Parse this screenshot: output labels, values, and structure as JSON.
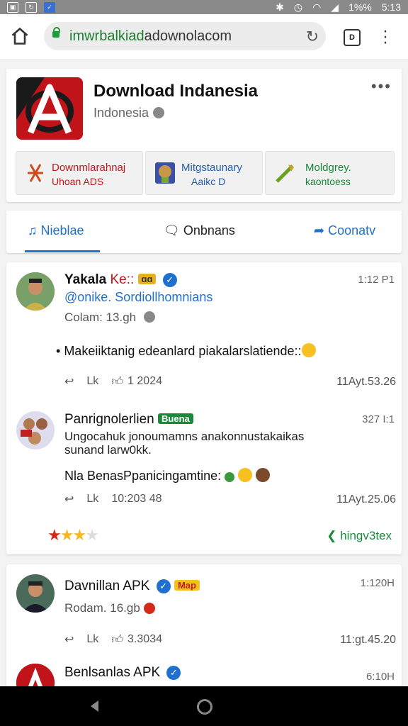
{
  "status_bar": {
    "battery": "1%%",
    "time": "5:13"
  },
  "browser": {
    "url_green": "imwrbalkiad",
    "url_rest": "adownolacom"
  },
  "app": {
    "title": "Download Indanesia",
    "subtitle": "Indonesia",
    "banners": [
      {
        "line1": "Downmlarahnaj",
        "line2": "Uhoan ADS",
        "color": "#c01818"
      },
      {
        "line1": "Mitgstaunary",
        "line2": "Aaikc D",
        "color": "#1f5fb0"
      },
      {
        "line1": "Moldgrey.",
        "line2": "kaontoess",
        "color": "#1a8a3a"
      }
    ]
  },
  "tabs": [
    {
      "label": "Nieblae",
      "icon": "music-note-icon",
      "active": true
    },
    {
      "label": "Onbnans",
      "icon": "chat-icon",
      "active": false
    },
    {
      "label": "Coonatv",
      "icon": "share-icon",
      "active": false
    }
  ],
  "posts": [
    {
      "name": "Yakala",
      "name_tag": "Ke::",
      "handle": "@onike. Sordiollhomnians",
      "meta": "Colam: 13.gh",
      "time": "1:12 P1",
      "body": "Makeiiktanig edeanlard piakalarslatiende::",
      "action_like": "Lk",
      "action_count": "1 2024",
      "date": "11Ayt.53.26"
    },
    {
      "name": "Panrignolerlien",
      "name_tag": "Buena",
      "body1": "Ungocahuk jonoumamns anakonnustakaikas",
      "body2": "sunand larw0kk.",
      "body3": "Nla BenasPpanicingamtine:",
      "time": "327 I:1",
      "action_like": "Lk",
      "action_count": "10:203 48",
      "date": "11Ayt.25.06",
      "rating": 3,
      "link": "hingv3tex"
    },
    {
      "name": "Davnillan APK",
      "name_tag": "Map",
      "meta": "Rodam. 16.gb",
      "time": "1:120H",
      "action_like": "Lk",
      "action_count": "3.3034",
      "date": "11:gt.45.20"
    },
    {
      "name": "Benlsanlas APK",
      "time": "6:10H"
    }
  ],
  "colors": {
    "accent": "#1f6fd0",
    "brand_red": "#c0141a",
    "link_green": "#1a8a3a"
  }
}
